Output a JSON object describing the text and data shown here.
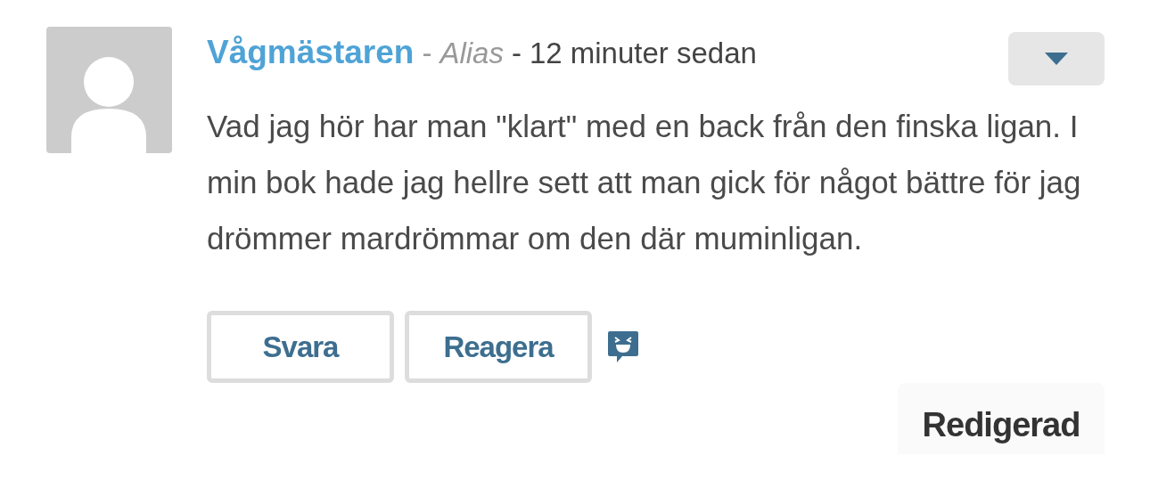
{
  "comment": {
    "author": "Vågmästaren",
    "alias": "Alias",
    "separator_1": "-",
    "separator_2": "-",
    "time": "12 minuter sedan",
    "text": "Vad jag hör har man \"klart\" med en back från den finska ligan. I min bok hade jag hellre sett att man gick för något bättre för jag drömmer mardrömmar om den där muminligan.",
    "buttons": [
      "Svara",
      "Reagera"
    ],
    "edited_label": "Redigerad"
  }
}
